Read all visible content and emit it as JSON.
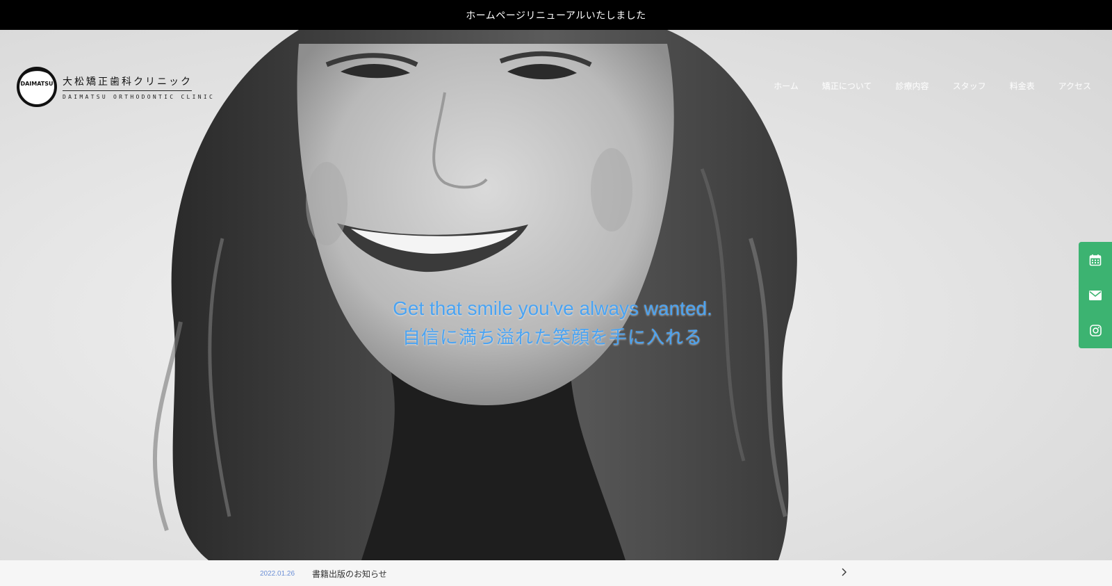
{
  "announcement": {
    "text": "ホームページリニューアルいたしました"
  },
  "logo": {
    "mark_text": "DAIMATSU",
    "name_jp": "大松矯正歯科クリニック",
    "name_en": "DAIMATSU ORTHODONTIC CLINIC"
  },
  "nav": {
    "items": [
      {
        "label": "ホーム"
      },
      {
        "label": "矯正について"
      },
      {
        "label": "診療内容"
      },
      {
        "label": "スタッフ"
      },
      {
        "label": "料金表"
      },
      {
        "label": "アクセス"
      }
    ]
  },
  "hero": {
    "tagline_en": "Get that smile you've always wanted.",
    "tagline_jp": "自信に満ち溢れた笑顔を手に入れる",
    "tagline_color": "#4aa3f2"
  },
  "side_rail": {
    "color": "#3cb371",
    "buttons": [
      {
        "icon": "calendar-icon"
      },
      {
        "icon": "mail-icon"
      },
      {
        "icon": "instagram-icon"
      }
    ]
  },
  "news": {
    "items": [
      {
        "date": "2022.01.26",
        "title": "書籍出版のお知らせ"
      }
    ]
  }
}
